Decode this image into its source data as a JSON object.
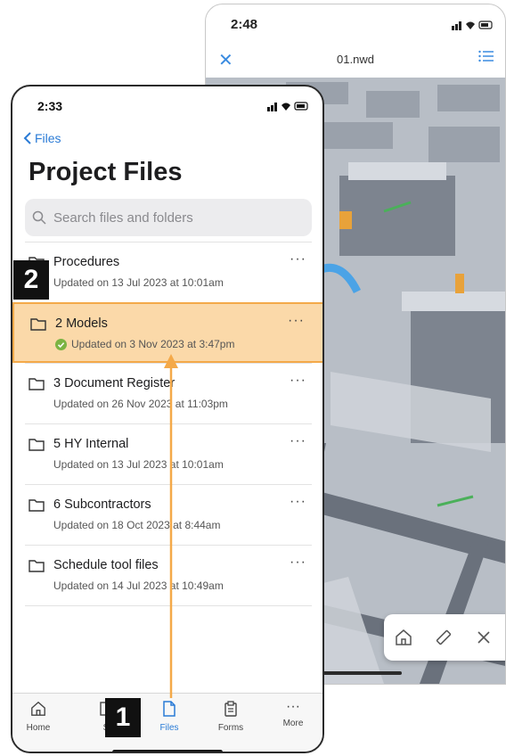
{
  "back_phone": {
    "time": "2:48",
    "file_name": "01.nwd",
    "close_icon": "close-icon",
    "list_icon": "list-icon",
    "toolbar": [
      "home-icon",
      "measure-icon",
      "close-icon"
    ]
  },
  "front_phone": {
    "time": "2:33",
    "back_label": "Files",
    "title": "Project Files",
    "search_placeholder": "Search files and folders",
    "folders": [
      {
        "name": "Procedures",
        "meta": "Updated on 13 Jul 2023 at 10:01am",
        "synced": false
      },
      {
        "name": "2 Models",
        "meta": "Updated on 3 Nov 2023 at 3:47pm",
        "synced": true
      },
      {
        "name": "3 Document Register",
        "meta": "Updated on 26 Nov 2023 at 11:03pm",
        "synced": false
      },
      {
        "name": "5 HY Internal",
        "meta": "Updated on 13 Jul 2023 at 10:01am",
        "synced": false
      },
      {
        "name": "6 Subcontractors",
        "meta": "Updated on 18 Oct 2023 at 8:44am",
        "synced": false
      },
      {
        "name": "Schedule tool files",
        "meta": "Updated on 14 Jul 2023 at 10:49am",
        "synced": false
      }
    ],
    "more_label": "···",
    "tabs": [
      {
        "label": "Home",
        "icon": "home-icon"
      },
      {
        "label": "S",
        "icon": "sheets-icon"
      },
      {
        "label": "Files",
        "icon": "file-icon"
      },
      {
        "label": "Forms",
        "icon": "forms-icon"
      },
      {
        "label": "More",
        "icon": "more-icon"
      }
    ],
    "tab_more_glyph": "···"
  },
  "annotations": {
    "step1": "1",
    "step2": "2"
  },
  "colors": {
    "accent": "#2a7bd6",
    "highlight_fill": "#fbd9a9",
    "highlight_border": "#f4a949",
    "synced": "#7cb342"
  }
}
